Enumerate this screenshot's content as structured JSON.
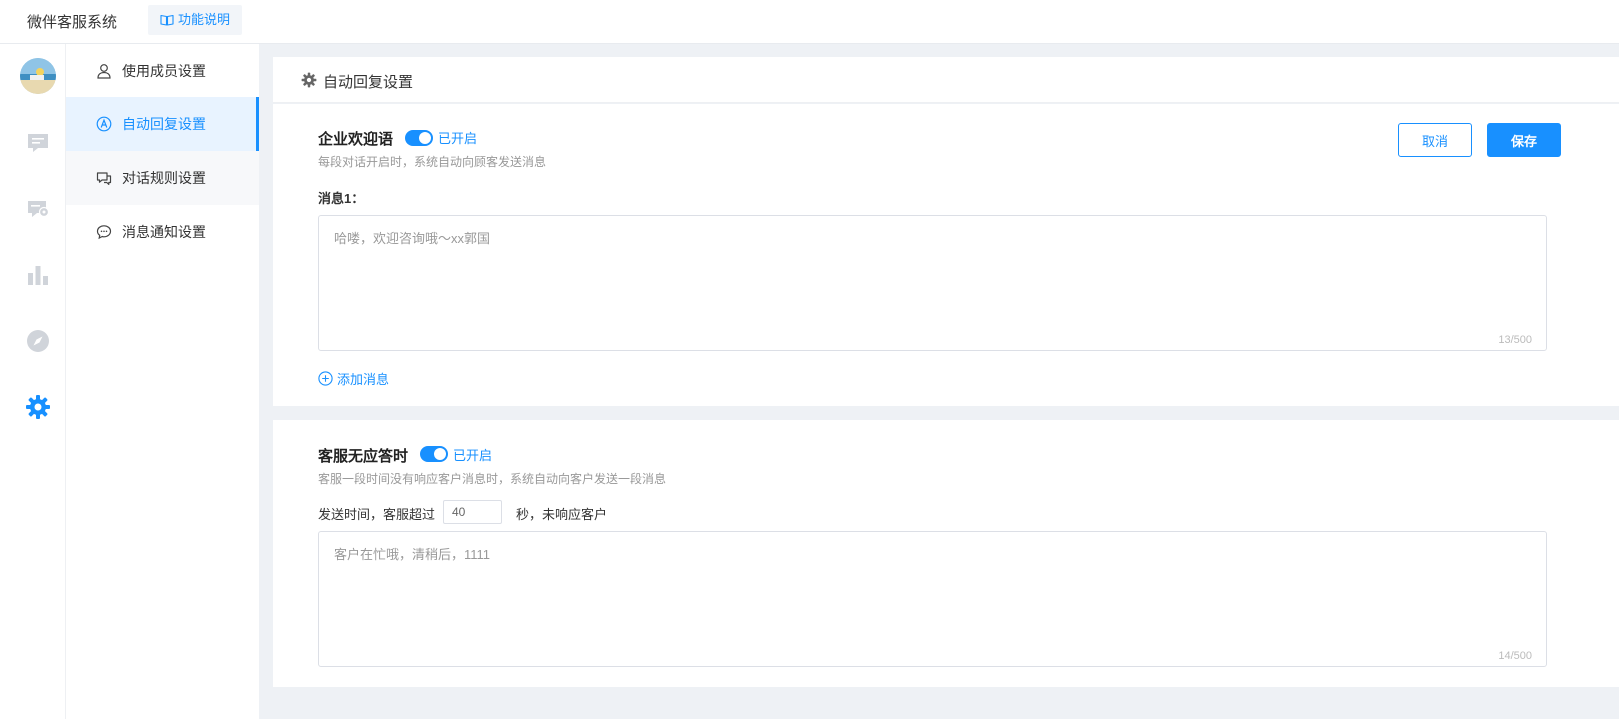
{
  "app": {
    "title": "微伴客服系统",
    "help_tab": "功能说明"
  },
  "sidebar": {
    "items": [
      {
        "label": "使用成员设置",
        "icon": "user-icon"
      },
      {
        "label": "自动回复设置",
        "icon": "auto-reply-icon"
      },
      {
        "label": "对话规则设置",
        "icon": "chat-rule-icon"
      },
      {
        "label": "消息通知设置",
        "icon": "message-icon"
      }
    ],
    "active_index": 1
  },
  "iconbar": {
    "icons": [
      "avatar",
      "chat-icon",
      "chat-settings-icon",
      "chart-icon",
      "compass-icon",
      "gear-icon"
    ],
    "active": "gear-icon"
  },
  "main": {
    "panel_title": "自动回复设置",
    "welcome": {
      "title": "企业欢迎语",
      "toggle_label": "已开启",
      "description": "每段对话开启时，系统自动向顾客发送消息",
      "message_label": "消息1：",
      "message_placeholder": "哈喽，欢迎咨询哦～xx郭国",
      "counter": "13/500",
      "add_message": "添加消息",
      "cancel": "取消",
      "save": "保存"
    },
    "no_reply": {
      "title": "客服无应答时",
      "toggle_label": "已开启",
      "description": "客服一段时间没有响应客户消息时，系统自动向客户发送一段消息",
      "send_prefix": "发送时间，客服超过",
      "seconds_value": "40",
      "send_suffix": "秒，未响应客户",
      "message_placeholder": "客户在忙哦，清稍后，1111",
      "counter": "14/500"
    }
  },
  "colors": {
    "accent": "#1890ff",
    "background": "#eef1f5",
    "active_menu_bg": "#e8f3ff"
  }
}
